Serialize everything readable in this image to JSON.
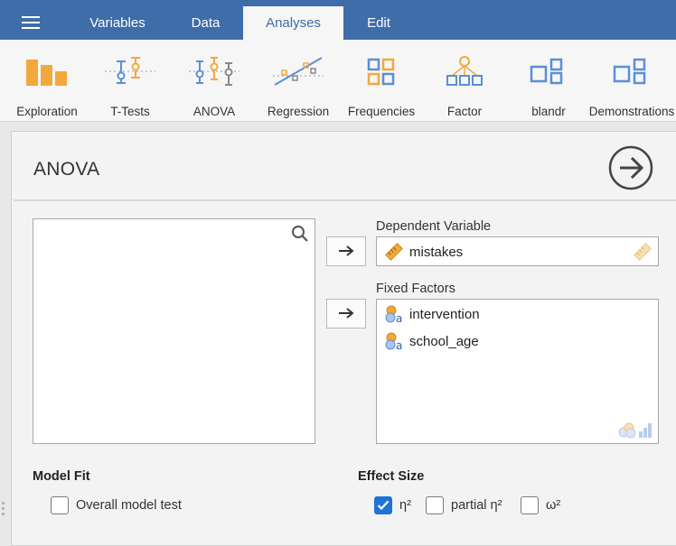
{
  "menu": {
    "tabs": [
      {
        "label": "Variables",
        "active": false
      },
      {
        "label": "Data",
        "active": false
      },
      {
        "label": "Analyses",
        "active": true
      },
      {
        "label": "Edit",
        "active": false
      }
    ]
  },
  "ribbon": {
    "items": [
      {
        "label": "Exploration",
        "icon": "exploration-icon"
      },
      {
        "label": "T-Tests",
        "icon": "t-tests-icon"
      },
      {
        "label": "ANOVA",
        "icon": "anova-icon"
      },
      {
        "label": "Regression",
        "icon": "regression-icon"
      },
      {
        "label": "Frequencies",
        "icon": "frequencies-icon"
      },
      {
        "label": "Factor",
        "icon": "factor-icon"
      },
      {
        "label": "blandr",
        "icon": "module-icon"
      },
      {
        "label": "Demonstrations",
        "icon": "module-icon"
      }
    ]
  },
  "analysis": {
    "title": "ANOVA",
    "dependent_label": "Dependent Variable",
    "dependent_value": "mistakes",
    "factors_label": "Fixed Factors",
    "factors": [
      "intervention",
      "school_age"
    ]
  },
  "model_fit": {
    "title": "Model Fit",
    "overall_label": "Overall model test",
    "overall_checked": false
  },
  "effect_size": {
    "title": "Effect Size",
    "options": [
      {
        "label": "η²",
        "checked": true
      },
      {
        "label": "partial η²",
        "checked": false
      },
      {
        "label": "ω²",
        "checked": false
      }
    ]
  },
  "colors": {
    "menubar": "#3e6da9",
    "accent_check": "#1f73d6",
    "icon_orange": "#f2a93b",
    "icon_blue": "#5b8fd6"
  }
}
